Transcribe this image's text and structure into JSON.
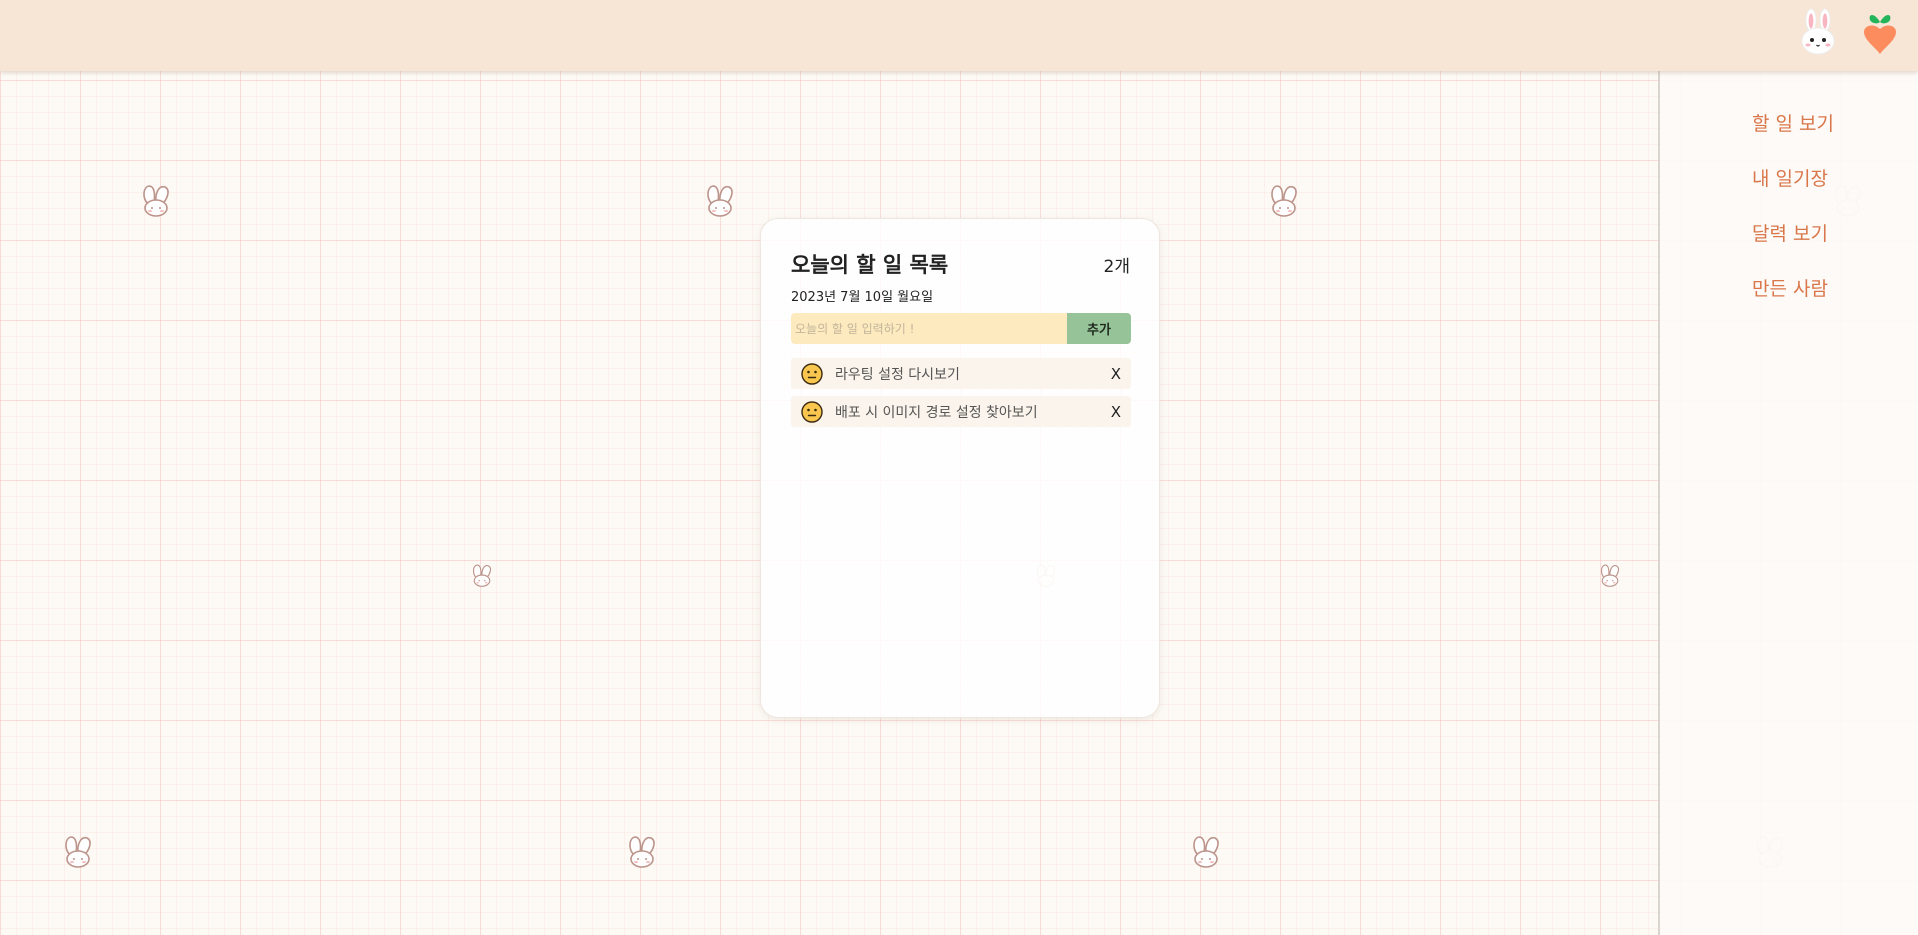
{
  "nav": {
    "items": [
      {
        "label": "할 일 보기"
      },
      {
        "label": "내 일기장"
      },
      {
        "label": "달력 보기"
      },
      {
        "label": "만든 사람"
      }
    ]
  },
  "todo": {
    "title": "오늘의 할 일 목록",
    "count": "2개",
    "date": "2023년 7월 10일 월요일",
    "input_placeholder": "오늘의 할 일 입력하기 !",
    "add_label": "추가",
    "items": [
      {
        "text": "라우팅 설정 다시보기",
        "delete_label": "X"
      },
      {
        "text": "배포 시 이미지 경로 설정 찾아보기",
        "delete_label": "X"
      }
    ]
  },
  "icons": {
    "header": [
      "bunny-face-icon",
      "carrot-icon"
    ],
    "item_status": "neutral-face-icon",
    "background": "bunny-ears-icon"
  },
  "colors": {
    "header_bg": "#f7e5d6",
    "nav_text": "#d9774a",
    "input_bg": "#fdebbf",
    "add_button_bg": "#97c399",
    "item_bg": "#fbf4ec",
    "grid_line": "#f0aaaa"
  }
}
